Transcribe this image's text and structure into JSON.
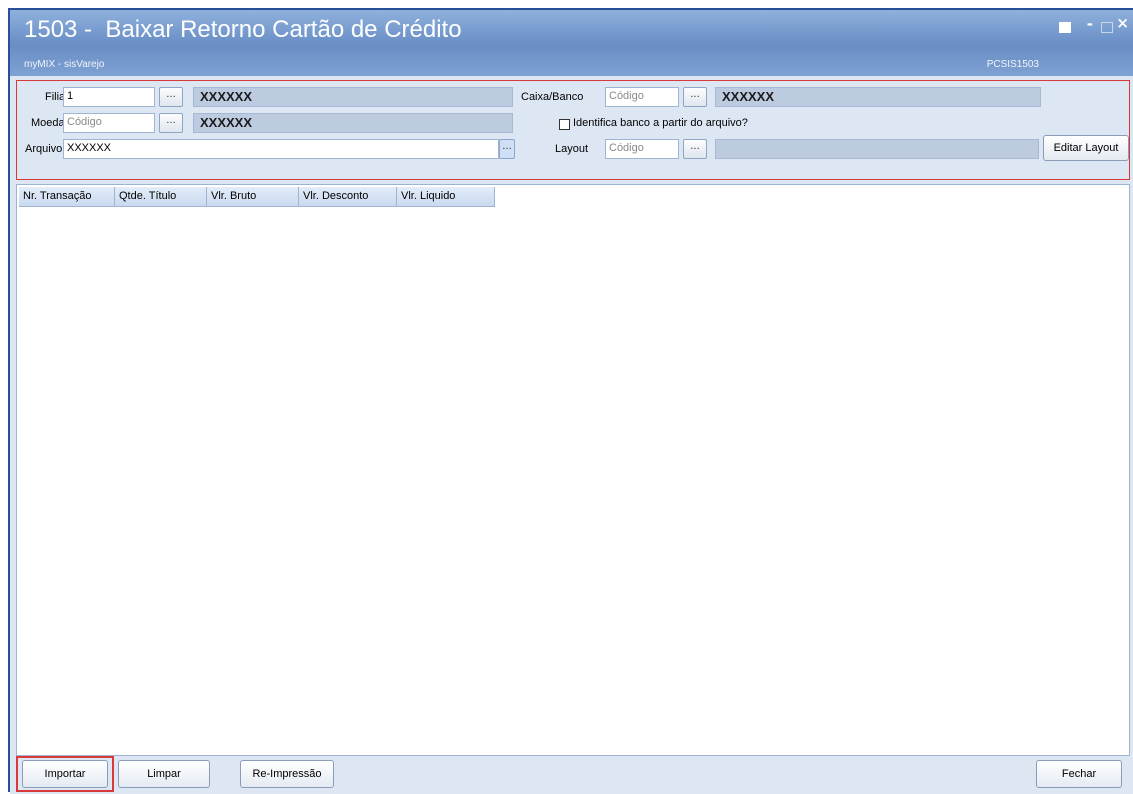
{
  "window": {
    "title": "1503 -  Baixar Retorno Cartão de Crédito",
    "subtitle": "myMIX - sisVarejo",
    "code": "PCSIS1503",
    "controls": {
      "restore": "",
      "minimize": "-",
      "maximize": "",
      "close": "×"
    }
  },
  "filters": {
    "filial": {
      "label": "Filial",
      "value": "1",
      "desc": "XXXXXX"
    },
    "moeda": {
      "label": "Moeda",
      "placeholder": "Código",
      "desc": "XXXXXX"
    },
    "arquivo": {
      "label": "Arquivo",
      "value": "XXXXXX"
    },
    "caixa_banco": {
      "label": "Caixa/Banco",
      "placeholder": "Código",
      "desc": "XXXXXX"
    },
    "identifica": {
      "label": "Identifica banco a partir do arquivo?",
      "checked": false
    },
    "layout": {
      "label": "Layout",
      "placeholder": "Código",
      "desc": ""
    },
    "dots": "...",
    "editar_layout": "Editar Layout"
  },
  "grid": {
    "columns": [
      "Nr. Transação",
      "Qtde. Título",
      "Vlr. Bruto",
      "Vlr. Desconto",
      "Vlr. Liquido"
    ],
    "rows": []
  },
  "buttons": {
    "importar": "Importar",
    "limpar": "Limpar",
    "reimpressao": "Re-Impressão",
    "fechar": "Fechar"
  },
  "colors": {
    "titlebar": "#7fa1d3",
    "highlight": "#d83a3a",
    "panel": "#dde7f4"
  }
}
